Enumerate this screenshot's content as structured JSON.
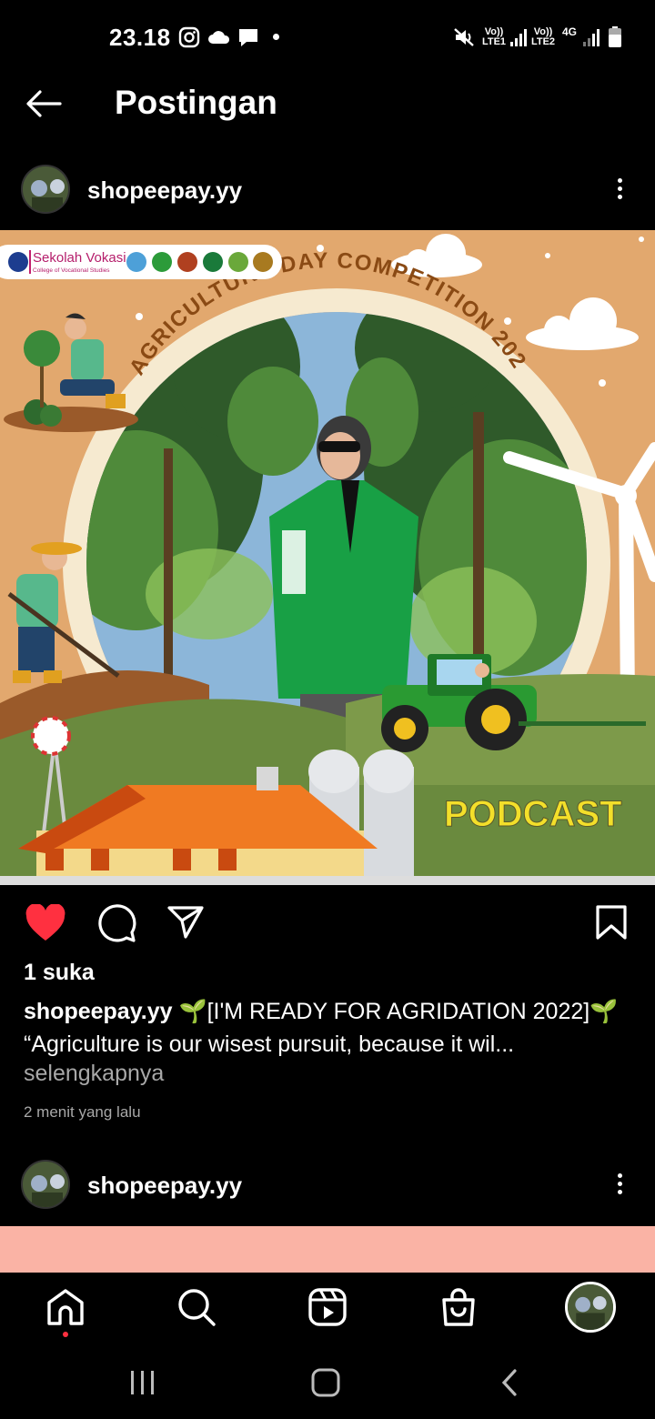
{
  "status_bar": {
    "time": "23.18",
    "sim1": "Vo)) LTE1",
    "sim2": "Vo)) LTE2",
    "network": "4G"
  },
  "header": {
    "title": "Postingan"
  },
  "post": {
    "username": "shopeepay.yy",
    "image": {
      "logo_text": "Sekolah Vokasi",
      "logo_subtext": "College of Vocational Studies",
      "arc_title": "AGRICULTURE DAY COMPETITION 2022",
      "badge": "PODCAST"
    },
    "liked": true,
    "likes": "1 suka",
    "caption_user": "shopeepay.yy",
    "caption_line1": "🌱[I'M READY FOR AGRIDATION 2022]🌱",
    "caption_line2": "“Agriculture is our wisest pursuit, because it wil...",
    "more_label": "selengkapnya",
    "time_ago": "2 menit yang lalu"
  },
  "next_post": {
    "username": "shopeepay.yy"
  },
  "colors": {
    "like_red": "#ff3040",
    "image_bg": "#e2a86e",
    "next_image_bg": "#fab3a5"
  },
  "icons": {
    "nav": [
      "home-icon",
      "search-icon",
      "reels-icon",
      "shop-icon",
      "profile-avatar"
    ],
    "actions": [
      "heart-icon",
      "comment-icon",
      "share-icon",
      "bookmark-icon"
    ]
  }
}
